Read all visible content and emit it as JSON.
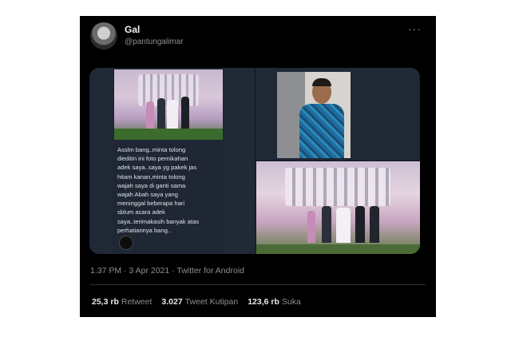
{
  "tweet": {
    "name": "Gal",
    "handle": "@pantungalimar",
    "more_icon": "···",
    "meta": "1.37 PM · 3 Apr 2021 · Twitter for Android",
    "stats": [
      {
        "count": "25,3 rb",
        "label": "Retweet"
      },
      {
        "count": "3.027",
        "label": "Tweet Kutipan"
      },
      {
        "count": "123,6 rb",
        "label": "Suka"
      }
    ]
  },
  "media": {
    "chat_text": "Asslm bang..minta tolong\ndieditin ini foto pernikahan\nadek saya..saya yg pakek jas\nhitam kanan,minta tolong\nwajah saya di ganti sama\nwajah Abah saya yang\nmeninggal beberapa hari\nsblum acara adek\nsaya..terimakasih banyak atas\nperhatiannya bang.."
  },
  "colors": {
    "background": "#000000",
    "text_primary": "#e7e9ea",
    "text_secondary": "#8b8f94"
  }
}
